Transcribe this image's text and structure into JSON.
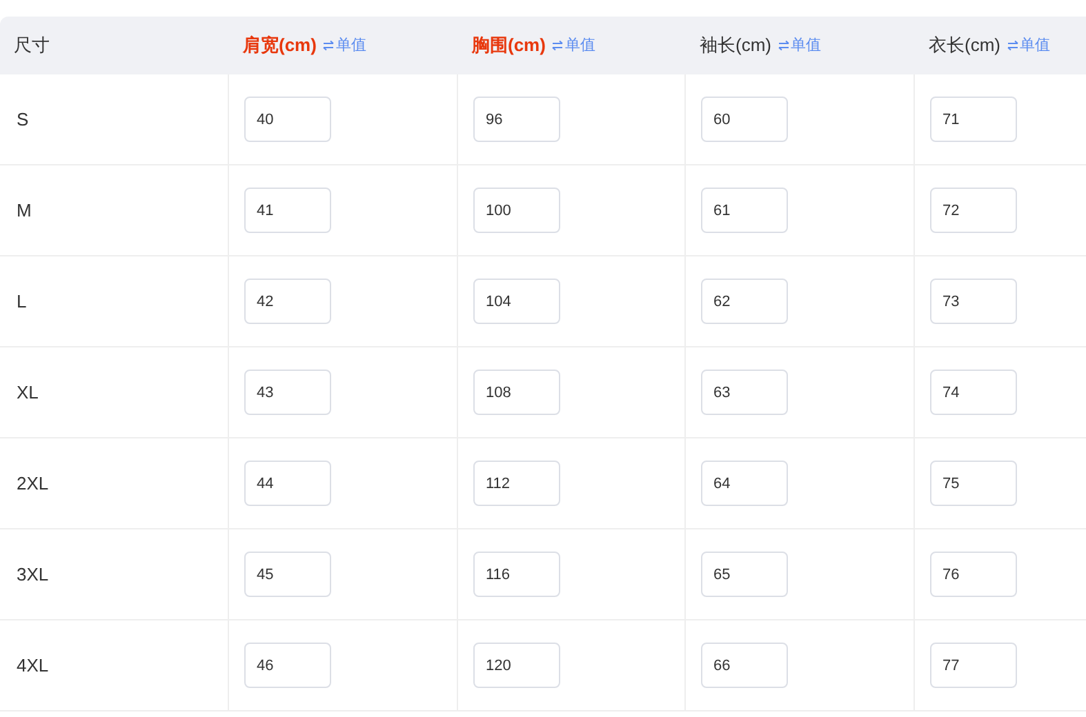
{
  "table": {
    "columns": [
      {
        "label": "尺寸",
        "highlighted": false
      },
      {
        "label": "肩宽(cm)",
        "highlighted": true,
        "toggle": "单值"
      },
      {
        "label": "胸围(cm)",
        "highlighted": true,
        "toggle": "单值"
      },
      {
        "label": "袖长(cm)",
        "highlighted": false,
        "toggle": "单值"
      },
      {
        "label": "衣长(cm)",
        "highlighted": false,
        "toggle": "单值"
      }
    ],
    "rows": [
      {
        "size": "S",
        "values": [
          "40",
          "96",
          "60",
          "71"
        ]
      },
      {
        "size": "M",
        "values": [
          "41",
          "100",
          "61",
          "72"
        ]
      },
      {
        "size": "L",
        "values": [
          "42",
          "104",
          "62",
          "73"
        ]
      },
      {
        "size": "XL",
        "values": [
          "43",
          "108",
          "63",
          "74"
        ]
      },
      {
        "size": "2XL",
        "values": [
          "44",
          "112",
          "64",
          "75"
        ]
      },
      {
        "size": "3XL",
        "values": [
          "45",
          "116",
          "65",
          "76"
        ]
      },
      {
        "size": "4XL",
        "values": [
          "46",
          "120",
          "66",
          "77"
        ]
      }
    ]
  }
}
